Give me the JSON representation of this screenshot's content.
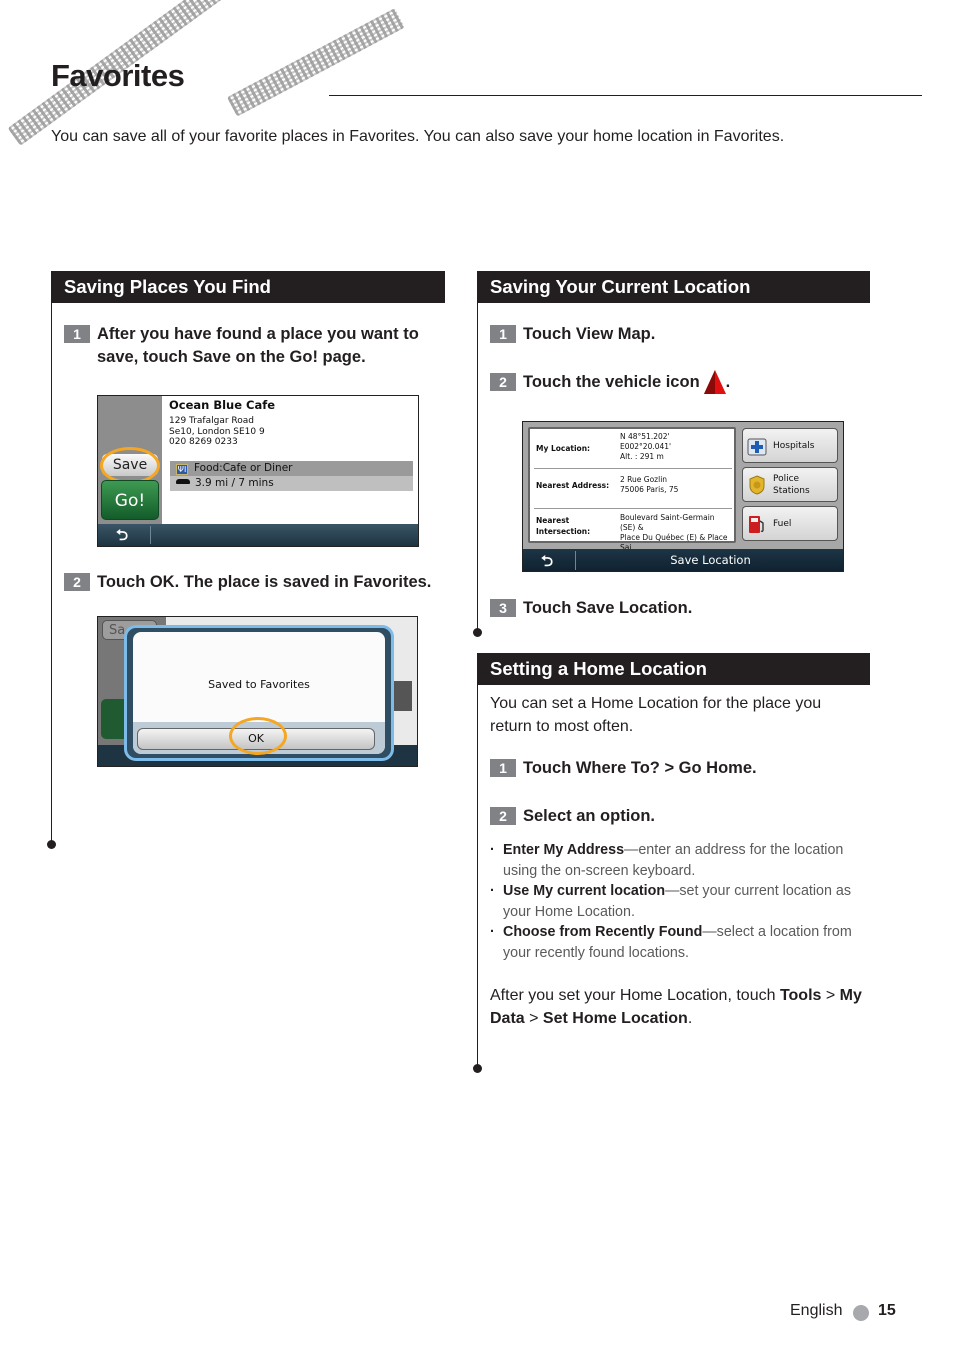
{
  "page": {
    "title": "Favorites",
    "intro": "You can save all of your favorite places in Favorites. You can also save your home location in Favorites."
  },
  "sections": {
    "saving_places": {
      "heading": "Saving Places You Find",
      "steps": [
        {
          "num": "1",
          "text": "After you have found a place you want to save, touch Save on the Go! page."
        },
        {
          "num": "2",
          "text": "Touch OK. The place is saved in Favorites."
        }
      ],
      "screen1": {
        "place_name": "Ocean Blue Cafe",
        "address_lines": [
          "129 Trafalgar Road",
          "Se10, London SE10 9",
          "020 8269 0233"
        ],
        "category": "Food:Cafe or Diner",
        "distance": "3.9 mi /  7 mins",
        "save_button": "Save",
        "go_button": "Go!",
        "highlight_color": "#f5a623"
      },
      "screen2": {
        "ghost_save": "Sa",
        "dialog_message": "Saved to Favorites",
        "ok_button": "OK"
      }
    },
    "saving_current": {
      "heading": "Saving Your Current Location",
      "steps": [
        {
          "num": "1",
          "text": "Touch View Map."
        },
        {
          "num": "2",
          "text": "Touch the vehicle icon"
        },
        {
          "num": "3",
          "text": "Touch Save Location."
        }
      ],
      "step2_suffix": ".",
      "screen3": {
        "my_location_label": "My Location:",
        "my_location_values": [
          "N 48°51.202'",
          "E002°20.041'",
          "Alt. : 291 m"
        ],
        "nearest_address_label": "Nearest Address:",
        "nearest_address_values": [
          "2 Rue Gozlin",
          "75006 Paris, 75"
        ],
        "nearest_intersection_label": [
          "Nearest",
          "Intersection:"
        ],
        "nearest_intersection_values": [
          "Boulevard Saint-Germain (SE) &",
          "Place Du Québec (E) & Place Sai"
        ],
        "poi_buttons": [
          {
            "icon": "hospital-icon",
            "label": [
              "Hospitals"
            ]
          },
          {
            "icon": "police-badge-icon",
            "label": [
              "Police",
              "Stations"
            ]
          },
          {
            "icon": "fuel-pump-icon",
            "label": [
              "Fuel"
            ]
          }
        ],
        "bottom_label": "Save Location"
      }
    },
    "home_location": {
      "heading": "Setting a Home Location",
      "intro": "You can set a Home Location for the place you return to most often.",
      "steps": [
        {
          "num": "1",
          "text": "Touch Where To? > Go Home."
        },
        {
          "num": "2",
          "text": "Select an option."
        }
      ],
      "options": [
        {
          "bold": "Enter My Address",
          "rest": "—enter an address for the location using the on-screen keyboard."
        },
        {
          "bold": "Use My current location",
          "rest": "—set your current location as your Home Location."
        },
        {
          "bold": "Choose from Recently Found",
          "rest": "—select a location from your recently found locations."
        }
      ],
      "after": {
        "p1": "After you set your Home Location, touch ",
        "tools": "Tools",
        "sep1": " > ",
        "my_data": "My Data",
        "sep2": " > ",
        "set_home": "Set Home Location",
        "end": "."
      }
    }
  },
  "footer": {
    "language": "English",
    "page_number": "15"
  },
  "colors": {
    "section_header_bg": "#231f20",
    "step_number_bg": "#808285",
    "highlight_ring": "#f5a623",
    "vehicle_icon": "#e01010"
  }
}
